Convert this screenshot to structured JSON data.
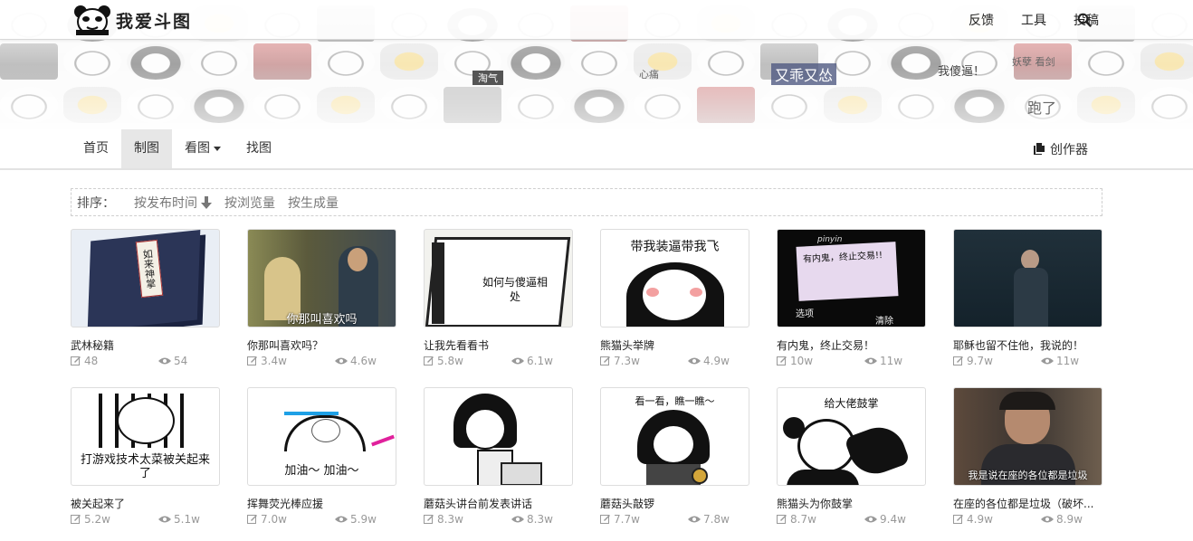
{
  "app": {
    "logo_text": "我爱斗图"
  },
  "topnav": {
    "links": [
      {
        "label": "反馈"
      },
      {
        "label": "工具"
      },
      {
        "label": "投稿"
      }
    ]
  },
  "subnav": {
    "items": [
      {
        "label": "首页"
      },
      {
        "label": "制图",
        "active": true
      },
      {
        "label": "看图",
        "dropdown": true
      },
      {
        "label": "找图"
      }
    ],
    "creator_label": "创作器"
  },
  "sort": {
    "label": "排序：",
    "options": [
      {
        "label": "按发布时间",
        "icon": "arrow-down-icon"
      },
      {
        "label": "按浏览量"
      },
      {
        "label": "按生成量"
      }
    ]
  },
  "cards": [
    {
      "title": "武林秘籍",
      "edits": "48",
      "views": "54",
      "caption": "如来神掌"
    },
    {
      "title": "你那叫喜欢吗？",
      "edits": "3.4w",
      "views": "4.6w",
      "caption": "你那叫喜欢吗"
    },
    {
      "title": "让我先看看书",
      "edits": "5.8w",
      "views": "6.1w",
      "caption": "如何与傻逼相处"
    },
    {
      "title": "熊猫头举牌",
      "edits": "7.3w",
      "views": "4.9w",
      "caption": "带我装逼带我飞"
    },
    {
      "title": "有内鬼，终止交易！",
      "edits": "10w",
      "views": "11w",
      "caption": "有内鬼，终止交易!!",
      "phone_brand": "pinyin",
      "left_key": "选项",
      "right_key": "清除"
    },
    {
      "title": "耶稣也留不住他，我说的！",
      "edits": "9.7w",
      "views": "11w",
      "caption": ""
    },
    {
      "title": "被关起来了",
      "edits": "5.2w",
      "views": "5.1w",
      "caption": "打游戏技术太菜被关起来了"
    },
    {
      "title": "挥舞荧光棒应援",
      "edits": "7.0w",
      "views": "5.9w",
      "caption": "加油～ 加油～"
    },
    {
      "title": "蘑菇头讲台前发表讲话",
      "edits": "8.3w",
      "views": "8.3w",
      "caption": ""
    },
    {
      "title": "蘑菇头敲锣",
      "edits": "7.7w",
      "views": "7.8w",
      "caption": "看一看，瞧一瞧～"
    },
    {
      "title": "熊猫头为你鼓掌",
      "edits": "8.7w",
      "views": "9.4w",
      "caption": "给大佬鼓掌"
    },
    {
      "title": "在座的各位都是垃圾（破坏...",
      "edits": "4.9w",
      "views": "8.9w",
      "caption": "我是说在座的各位都是垃圾"
    }
  ],
  "banner": {
    "bg_texts": [
      "淘气",
      "又乖又怂",
      "我傻逼！",
      "跑了",
      "心痛",
      "妖孽 看剑"
    ]
  },
  "colors": {
    "accent": "#333333",
    "muted": "#999999",
    "active_tab_bg": "#e7e7e7"
  }
}
